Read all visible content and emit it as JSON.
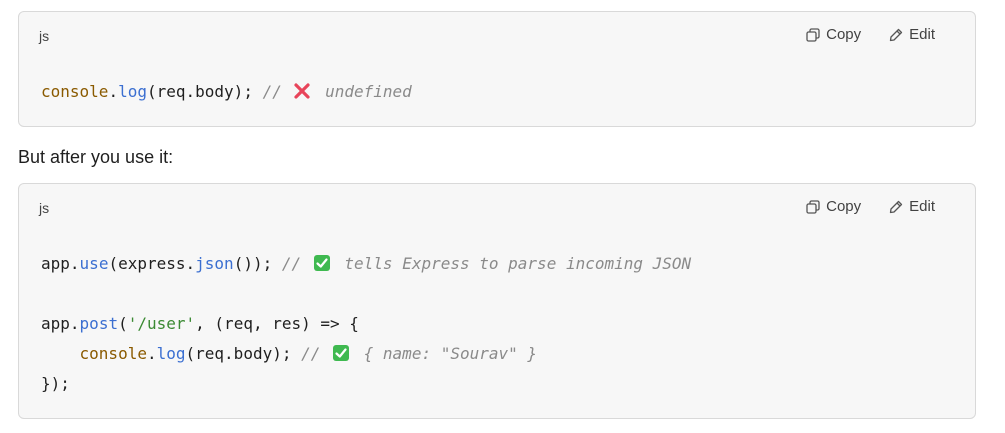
{
  "blocks": [
    {
      "lang": "js",
      "copy_label": "Copy",
      "edit_label": "Edit",
      "lines": [
        {
          "tokens": [
            {
              "t": "console",
              "c": "obj"
            },
            {
              "t": ".",
              "c": "punc"
            },
            {
              "t": "log",
              "c": "fn"
            },
            {
              "t": "(req.body); ",
              "c": "plain"
            },
            {
              "t": "// ",
              "c": "com"
            },
            {
              "emoji": "cross-mark-icon"
            },
            {
              "t": " undefined",
              "c": "com"
            }
          ]
        }
      ]
    },
    {
      "lang": "js",
      "copy_label": "Copy",
      "edit_label": "Edit",
      "lines": [
        {
          "tokens": [
            {
              "t": "app",
              "c": "plain"
            },
            {
              "t": ".",
              "c": "punc"
            },
            {
              "t": "use",
              "c": "fn"
            },
            {
              "t": "(express.",
              "c": "plain"
            },
            {
              "t": "json",
              "c": "fn"
            },
            {
              "t": "()); ",
              "c": "plain"
            },
            {
              "t": "// ",
              "c": "com"
            },
            {
              "emoji": "check-mark-icon"
            },
            {
              "t": " tells Express to parse incoming JSON",
              "c": "com"
            }
          ]
        },
        {
          "tokens": [
            {
              "t": "",
              "c": "plain"
            }
          ]
        },
        {
          "tokens": [
            {
              "t": "app",
              "c": "plain"
            },
            {
              "t": ".",
              "c": "punc"
            },
            {
              "t": "post",
              "c": "fn"
            },
            {
              "t": "(",
              "c": "plain"
            },
            {
              "t": "'/user'",
              "c": "str"
            },
            {
              "t": ", (req, res) => {",
              "c": "plain"
            }
          ]
        },
        {
          "tokens": [
            {
              "t": "    ",
              "c": "plain"
            },
            {
              "t": "console",
              "c": "obj"
            },
            {
              "t": ".",
              "c": "punc"
            },
            {
              "t": "log",
              "c": "fn"
            },
            {
              "t": "(req.body); ",
              "c": "plain"
            },
            {
              "t": "// ",
              "c": "com"
            },
            {
              "emoji": "check-mark-icon"
            },
            {
              "t": " { name: \"Sourav\" }",
              "c": "com"
            }
          ]
        },
        {
          "tokens": [
            {
              "t": "});",
              "c": "plain"
            }
          ]
        }
      ]
    }
  ],
  "prose": "But after you use it:",
  "colors": {
    "code_bg": "#f7f7f7",
    "border": "#d9d9d9",
    "object": "#8a5a00",
    "function": "#3b6fd1",
    "string": "#3b8a33",
    "comment": "#8a8a8a",
    "cross": "#e8445a",
    "check_bg": "#3fb950"
  }
}
